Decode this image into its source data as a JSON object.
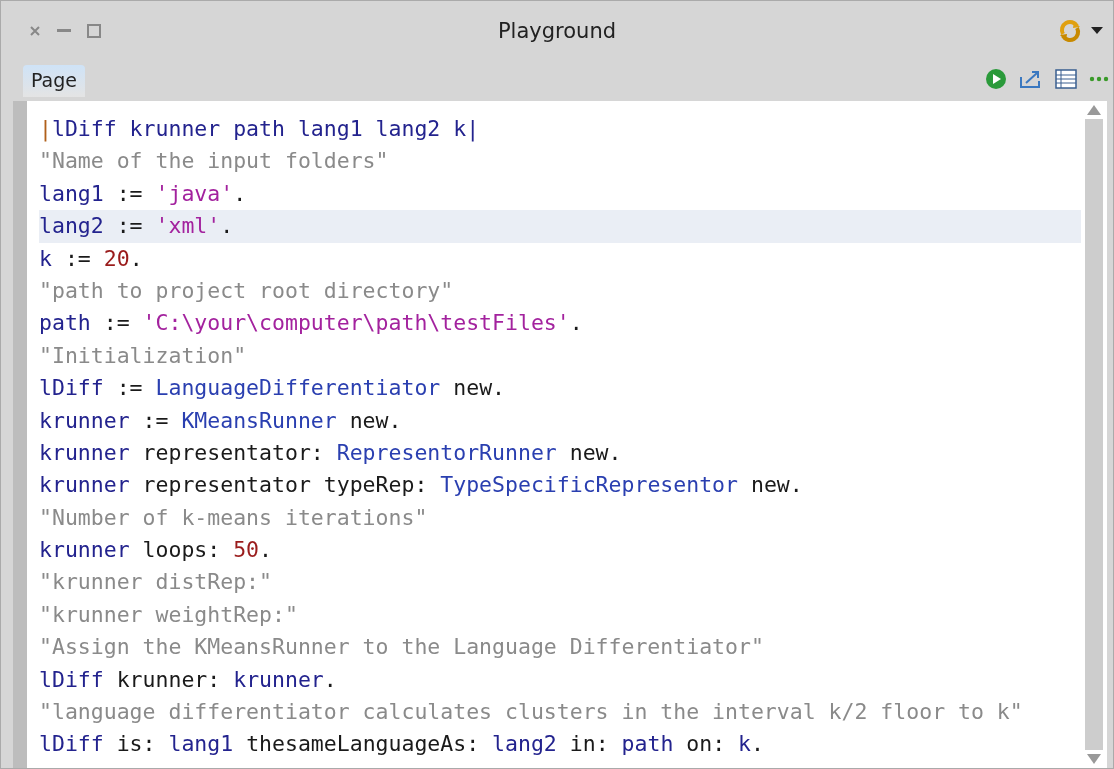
{
  "window": {
    "title": "Playground"
  },
  "tabs": [
    {
      "label": "Page",
      "selected": true
    }
  ],
  "code_lines": [
    {
      "highlighted": false,
      "tokens": [
        {
          "kind": "delim",
          "text": "|"
        },
        {
          "kind": "var",
          "text": "lDiff krunner path lang1 lang2 k|"
        }
      ]
    },
    {
      "highlighted": false,
      "tokens": [
        {
          "kind": "comment",
          "text": "\"Name of the input folders\""
        }
      ]
    },
    {
      "highlighted": false,
      "tokens": [
        {
          "kind": "var",
          "text": "lang1"
        },
        {
          "kind": "plain",
          "text": " := "
        },
        {
          "kind": "string",
          "text": "'java'"
        },
        {
          "kind": "plain",
          "text": "."
        }
      ]
    },
    {
      "highlighted": true,
      "tokens": [
        {
          "kind": "var",
          "text": "lang2"
        },
        {
          "kind": "plain",
          "text": " := "
        },
        {
          "kind": "string",
          "text": "'xml'"
        },
        {
          "kind": "plain",
          "text": "."
        }
      ]
    },
    {
      "highlighted": false,
      "tokens": [
        {
          "kind": "var",
          "text": "k"
        },
        {
          "kind": "plain",
          "text": " := "
        },
        {
          "kind": "number",
          "text": "20"
        },
        {
          "kind": "plain",
          "text": "."
        }
      ]
    },
    {
      "highlighted": false,
      "tokens": [
        {
          "kind": "comment",
          "text": "\"path to project root directory\""
        }
      ]
    },
    {
      "highlighted": false,
      "tokens": [
        {
          "kind": "var",
          "text": "path"
        },
        {
          "kind": "plain",
          "text": " := "
        },
        {
          "kind": "string",
          "text": "'C:\\your\\computer\\path\\testFiles'"
        },
        {
          "kind": "plain",
          "text": "."
        }
      ]
    },
    {
      "highlighted": false,
      "tokens": [
        {
          "kind": "comment",
          "text": "\"Initialization\""
        }
      ]
    },
    {
      "highlighted": false,
      "tokens": [
        {
          "kind": "var",
          "text": "lDiff"
        },
        {
          "kind": "plain",
          "text": " := "
        },
        {
          "kind": "class",
          "text": "LanguageDifferentiator"
        },
        {
          "kind": "plain",
          "text": " new."
        }
      ]
    },
    {
      "highlighted": false,
      "tokens": [
        {
          "kind": "var",
          "text": "krunner"
        },
        {
          "kind": "plain",
          "text": " := "
        },
        {
          "kind": "class",
          "text": "KMeansRunner"
        },
        {
          "kind": "plain",
          "text": " new."
        }
      ]
    },
    {
      "highlighted": false,
      "tokens": [
        {
          "kind": "var",
          "text": "krunner"
        },
        {
          "kind": "plain",
          "text": " representator: "
        },
        {
          "kind": "class",
          "text": "RepresentorRunner"
        },
        {
          "kind": "plain",
          "text": " new."
        }
      ]
    },
    {
      "highlighted": false,
      "tokens": [
        {
          "kind": "var",
          "text": "krunner"
        },
        {
          "kind": "plain",
          "text": " representator typeRep: "
        },
        {
          "kind": "class",
          "text": "TypeSpecificRepresentor"
        },
        {
          "kind": "plain",
          "text": " new."
        }
      ]
    },
    {
      "highlighted": false,
      "tokens": [
        {
          "kind": "comment",
          "text": "\"Number of k-means iterations\""
        }
      ]
    },
    {
      "highlighted": false,
      "tokens": [
        {
          "kind": "var",
          "text": "krunner"
        },
        {
          "kind": "plain",
          "text": " loops: "
        },
        {
          "kind": "number",
          "text": "50"
        },
        {
          "kind": "plain",
          "text": "."
        }
      ]
    },
    {
      "highlighted": false,
      "tokens": [
        {
          "kind": "comment",
          "text": "\"krunner distRep:\""
        }
      ]
    },
    {
      "highlighted": false,
      "tokens": [
        {
          "kind": "comment",
          "text": "\"krunner weightRep:\""
        }
      ]
    },
    {
      "highlighted": false,
      "tokens": [
        {
          "kind": "comment",
          "text": "\"Assign the KMeansRunner to the Language Differentiator\""
        }
      ]
    },
    {
      "highlighted": false,
      "tokens": [
        {
          "kind": "var",
          "text": "lDiff"
        },
        {
          "kind": "plain",
          "text": " krunner: "
        },
        {
          "kind": "var",
          "text": "krunner"
        },
        {
          "kind": "plain",
          "text": "."
        }
      ]
    },
    {
      "highlighted": false,
      "tokens": [
        {
          "kind": "comment",
          "text": "\"language differentiator calculates clusters in the interval k/2 floor to k\""
        }
      ]
    },
    {
      "highlighted": false,
      "tokens": [
        {
          "kind": "var",
          "text": "lDiff"
        },
        {
          "kind": "plain",
          "text": " is: "
        },
        {
          "kind": "var",
          "text": "lang1"
        },
        {
          "kind": "plain",
          "text": " thesameLanguageAs: "
        },
        {
          "kind": "var",
          "text": "lang2"
        },
        {
          "kind": "plain",
          "text": " in: "
        },
        {
          "kind": "var",
          "text": "path"
        },
        {
          "kind": "plain",
          "text": " on: "
        },
        {
          "kind": "var",
          "text": "k"
        },
        {
          "kind": "plain",
          "text": "."
        }
      ]
    }
  ]
}
